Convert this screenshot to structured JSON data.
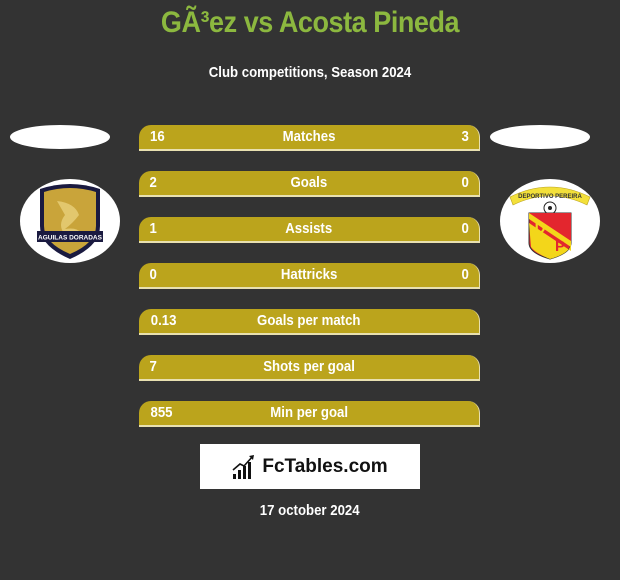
{
  "header": {
    "title": "GÃ³ez vs Acosta Pineda",
    "subtitle": "Club competitions, Season 2024"
  },
  "teams": {
    "left": {
      "name": "Aguilas Doradas",
      "badge_text": "AGUILAS DORADAS"
    },
    "right": {
      "name": "Deportivo Pereira",
      "badge_text": "DEPORTIVO PEREIRA",
      "initials": [
        "D",
        "P"
      ]
    }
  },
  "colors": {
    "title": "#8cb83f",
    "bar": "#bba41c",
    "background": "#333333"
  },
  "stats": [
    {
      "label": "Matches",
      "left": "16",
      "right": "3"
    },
    {
      "label": "Goals",
      "left": "2",
      "right": "0"
    },
    {
      "label": "Assists",
      "left": "1",
      "right": "0"
    },
    {
      "label": "Hattricks",
      "left": "0",
      "right": "0"
    },
    {
      "label": "Goals per match",
      "left": "0.13",
      "right": ""
    },
    {
      "label": "Shots per goal",
      "left": "7",
      "right": ""
    },
    {
      "label": "Min per goal",
      "left": "855",
      "right": ""
    }
  ],
  "brand": {
    "name": "FcTables.com",
    "icon": "bar-chart-icon"
  },
  "footer": {
    "date": "17 october 2024"
  }
}
